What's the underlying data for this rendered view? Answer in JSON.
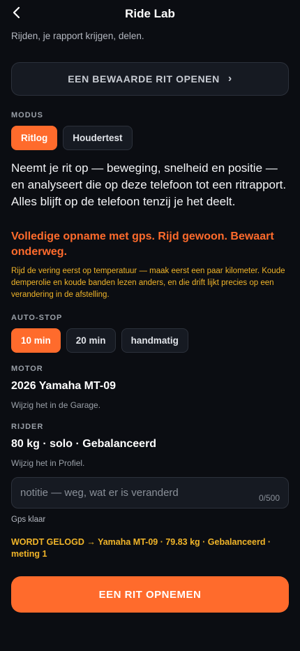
{
  "header": {
    "title": "Ride Lab"
  },
  "subtitle": "Rijden, je rapport krijgen, delen.",
  "open_saved": {
    "label": "EEN BEWAARDE RIT OPENEN"
  },
  "mode": {
    "label": "MODUS",
    "options": [
      "Ritlog",
      "Houdertest"
    ],
    "selected": "Ritlog"
  },
  "description": "Neemt je rit op — beweging, snelheid en positie — en analyseert die op deze telefoon tot een ritrapport. Alles blijft op de telefoon tenzij je het deelt.",
  "accent_note": "Volledige opname met gps. Rijd gewoon. Bewaart onderweg.",
  "warning": "Rijd de vering eerst op temperatuur — maak eerst een paar kilometer. Koude demperolie en koude banden lezen anders, en die drift lijkt precies op een verandering in de afstelling.",
  "auto_stop": {
    "label": "AUTO-STOP",
    "options": [
      "10 min",
      "20 min",
      "handmatig"
    ],
    "selected": "10 min"
  },
  "motor": {
    "label": "MOTOR",
    "value": "2026 Yamaha MT-09",
    "hint": "Wijzig het in de Garage."
  },
  "rider": {
    "label": "RIJDER",
    "value": "80 kg · solo · Gebalanceerd",
    "hint": "Wijzig het in Profiel."
  },
  "note": {
    "placeholder": "notitie — weg, wat er is veranderd",
    "value": "",
    "count": "0/500"
  },
  "gps_status": "Gps klaar",
  "logged_summary": "WORDT GELOGD → Yamaha MT-09 · 79.83 kg · Gebalanceerd · meting 1",
  "record_button": {
    "label": "EEN RIT OPNEMEN"
  },
  "colors": {
    "accent": "#ff6b2c",
    "warning": "#f0b429",
    "background": "#0b0d12"
  }
}
